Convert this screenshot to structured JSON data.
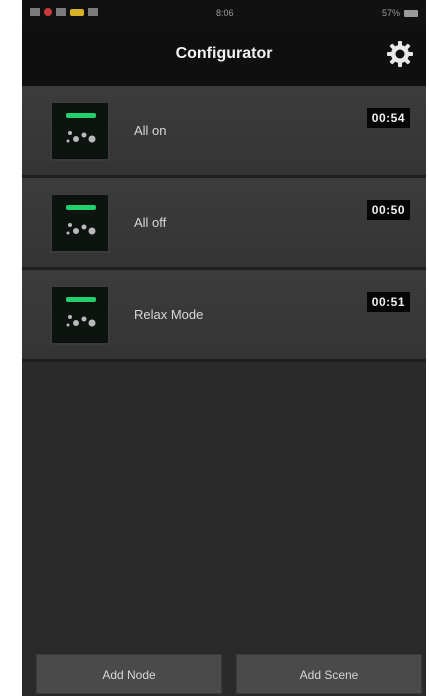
{
  "status_bar": {
    "time": "8:06",
    "battery": "57%"
  },
  "header": {
    "title": "Configurator",
    "settings_icon": "gear-icon"
  },
  "scenes": [
    {
      "name": "All on",
      "time": "00:54",
      "icon": "scene-thumbnail-icon"
    },
    {
      "name": "All off",
      "time": "00:50",
      "icon": "scene-thumbnail-icon"
    },
    {
      "name": "Relax Mode",
      "time": "00:51",
      "icon": "scene-thumbnail-icon"
    }
  ],
  "footer": {
    "add_node_label": "Add Node",
    "add_scene_label": "Add Scene"
  },
  "colors": {
    "background": "#2a2a2a",
    "header": "#0f0f0f",
    "row": "#3a3a3a",
    "accent_green": "#20d06a"
  }
}
